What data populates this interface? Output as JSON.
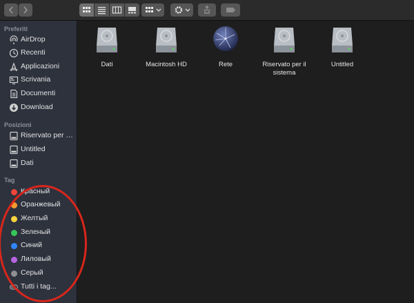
{
  "toolbar": {
    "back": "back",
    "forward": "forward",
    "views": [
      "icon-view",
      "list-view",
      "column-view",
      "gallery-view"
    ]
  },
  "sidebar": {
    "sections": {
      "favorites": "Preferiti",
      "locations": "Posizioni",
      "tags": "Tag"
    },
    "favorites": [
      {
        "label": "AirDrop",
        "icon": "airdrop-icon"
      },
      {
        "label": "Recenti",
        "icon": "clock-icon"
      },
      {
        "label": "Applicazioni",
        "icon": "applications-icon"
      },
      {
        "label": "Scrivania",
        "icon": "desktop-icon"
      },
      {
        "label": "Documenti",
        "icon": "document-icon"
      },
      {
        "label": "Download",
        "icon": "download-icon"
      }
    ],
    "locations": [
      {
        "label": "Riservato per il...",
        "icon": "disk-icon"
      },
      {
        "label": "Untitled",
        "icon": "disk-icon"
      },
      {
        "label": "Dati",
        "icon": "disk-icon"
      }
    ],
    "tags": [
      {
        "label": "Красный",
        "color": "#f0453a"
      },
      {
        "label": "Оранжевый",
        "color": "#f79a2f"
      },
      {
        "label": "Желтый",
        "color": "#f8d43e"
      },
      {
        "label": "Зеленый",
        "color": "#36c75a"
      },
      {
        "label": "Синий",
        "color": "#2f86f5"
      },
      {
        "label": "Лиловый",
        "color": "#b765e0"
      },
      {
        "label": "Серый",
        "color": "#8e8e93"
      }
    ],
    "all_tags": "Tutti i tag..."
  },
  "files": [
    {
      "name": "Dati",
      "icon": "hard-disk-icon"
    },
    {
      "name": "Macintosh HD",
      "icon": "hard-disk-icon"
    },
    {
      "name": "Rete",
      "icon": "network-globe-icon"
    },
    {
      "name": "Riservato per il sistema",
      "icon": "hard-disk-icon"
    },
    {
      "name": "Untitled",
      "icon": "hard-disk-icon"
    }
  ],
  "annotation_color": "#d9261c"
}
